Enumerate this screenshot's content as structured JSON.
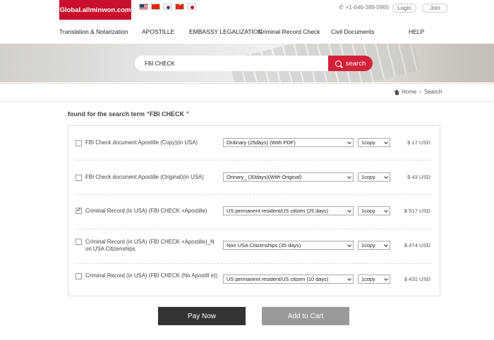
{
  "header": {
    "logo": "Global.allminwon.com",
    "flags": [
      "us-flag",
      "china-flag",
      "korea-flag",
      "vietnam-flag",
      "japan-flag"
    ],
    "phone": "+1-646-389-0965",
    "login": "Login",
    "join": "Join"
  },
  "nav": [
    "Translation & Notarization",
    "APOSTILLE",
    "EMBASSY LEGALIZATION",
    "Criminal Record Check",
    "Civil Documents",
    "HELP"
  ],
  "search": {
    "value": "FBI CHECK",
    "button": "search"
  },
  "breadcrumb": {
    "home": "Home",
    "separator": ">",
    "current": "Search"
  },
  "results": {
    "title": "found for the search term “FBI CHECK ”",
    "items": [
      {
        "name": "FBI Check document Apostille (Copy)(in USA)",
        "checked": false,
        "option": "Ordinary (25days) (With PDF)",
        "qty": "1copy",
        "price": "$ 17  USD"
      },
      {
        "name": "FBI Check document Apostille (Original)(in USA)",
        "checked": false,
        "option": "Orinary_ (30days)(With Original)",
        "qty": "1copy",
        "price": "$ 43  USD"
      },
      {
        "name": "Criminal Record (in USA) (FBI CHECK +Apostille)",
        "checked": true,
        "option": "US permanent resident/US citizen (25 days)",
        "qty": "1copy",
        "price": "$ 517  USD"
      },
      {
        "name": "Criminal Record (in USA) (FBI CHECK +Apostille)_N on USA Citizenships",
        "checked": false,
        "option": "Non USA Citizenships (35 days)",
        "qty": "1copy",
        "price": "$ 474  USD"
      },
      {
        "name": "Criminal Record (in USA) (FBI CHECK (No Apostill e))",
        "checked": false,
        "option": "US permanent resident/US citizen (10 days)",
        "qty": "1copy",
        "price": "$ 431  USD"
      }
    ]
  },
  "actions": {
    "pay": "Pay Now",
    "cart": "Add to Cart"
  },
  "colors": {
    "brand_red": "#c8102e",
    "search_red": "#d3213a",
    "pay_button": "#333333",
    "cart_button": "#9a9a9a"
  }
}
